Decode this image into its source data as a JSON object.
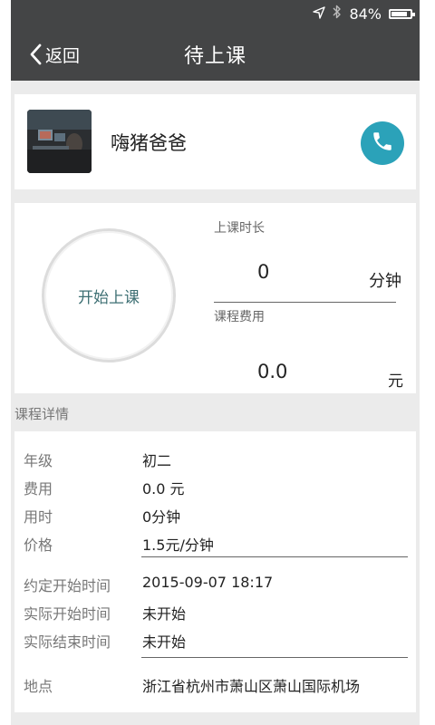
{
  "status_bar": {
    "battery_percent": "84%",
    "battery_level": 0.84,
    "icons": [
      "location-arrow-icon",
      "bluetooth-icon",
      "battery-icon"
    ]
  },
  "nav": {
    "back_label": "返回",
    "title": "待上课"
  },
  "contact": {
    "name": "嗨猪爸爸",
    "call_icon": "phone-icon",
    "accent_color": "#2ba2b9"
  },
  "timer": {
    "start_label": "开始上课",
    "duration_label": "上课时长",
    "duration_value": "0",
    "duration_unit": "分钟",
    "fee_label": "课程费用",
    "fee_value": "0.0",
    "fee_unit": "元"
  },
  "details": {
    "section_title": "课程详情",
    "rows": [
      {
        "label": "年级",
        "value": "初二"
      },
      {
        "label": "费用",
        "value": "0.0 元"
      },
      {
        "label": "用时",
        "value": "0分钟"
      },
      {
        "label": "价格",
        "value": "1.5元/分钟"
      },
      {
        "label": "约定开始时间",
        "value": "2015-09-07 18:17"
      },
      {
        "label": "实际开始时间",
        "value": "未开始"
      },
      {
        "label": "实际结束时间",
        "value": "未开始"
      },
      {
        "label": "地点",
        "value": "浙江省杭州市萧山区萧山国际机场"
      }
    ]
  }
}
